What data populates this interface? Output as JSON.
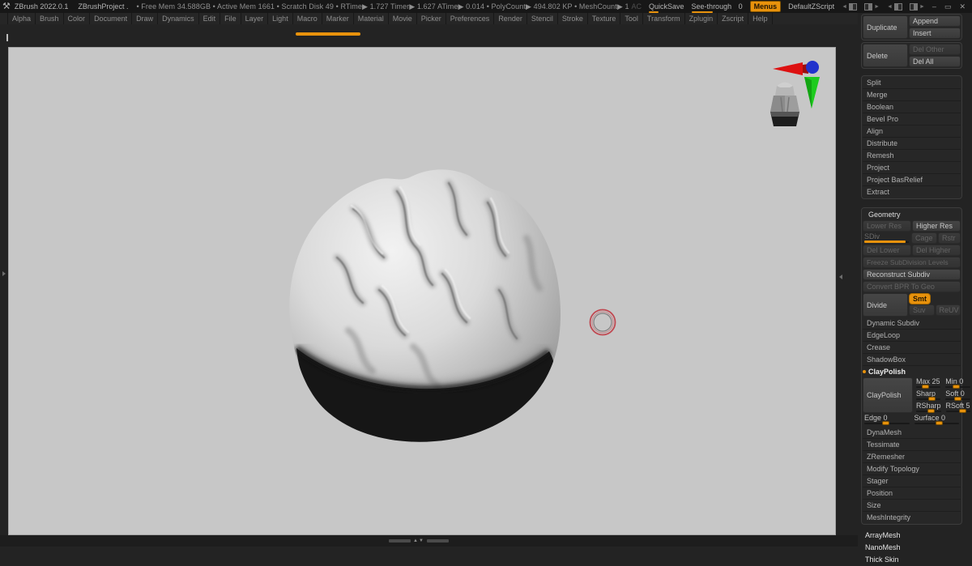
{
  "colors": {
    "accent_orange": "#e8920c",
    "canvas_grey": "#c7c7c7",
    "cursor_red": "#c04851",
    "gizmo_red": "#dd1111",
    "gizmo_green": "#1ecb1e",
    "gizmo_blue": "#2233cc"
  },
  "titlebar": {
    "app_title": "ZBrush 2022.0.1",
    "project_name": "ZBrushProject .",
    "stats": "• Free Mem 34.588GB • Active Mem 1661 • Scratch Disk 49 • RTime▶ 1.727 Timer▶ 1.627 ATime▶ 0.014 • PolyCount▶ 494.802 KP • MeshCount▶ 1",
    "ac_label": "AC",
    "quicksave_label": "QuickSave",
    "see_through_label": "See-through",
    "see_through_value": "0",
    "menus_button": "Menus",
    "default_zscript": "DefaultZScript",
    "minimize_glyph": "–",
    "restore_glyph": "▭",
    "close_glyph": "✕"
  },
  "menubar": {
    "items": [
      "Alpha",
      "Brush",
      "Color",
      "Document",
      "Draw",
      "Dynamics",
      "Edit",
      "File",
      "Layer",
      "Light",
      "Macro",
      "Marker",
      "Material",
      "Movie",
      "Picker",
      "Preferences",
      "Render",
      "Stencil",
      "Stroke",
      "Texture",
      "Tool",
      "Transform",
      "Zplugin",
      "Zscript",
      "Help"
    ]
  },
  "bottombar": {
    "divider_arrows": "▲▼"
  },
  "tool_panel": {
    "duplicate": "Duplicate",
    "append": "Append",
    "insert": "Insert",
    "delete": "Delete",
    "del_other": "Del Other",
    "del_all": "Del All",
    "subpalettes": [
      "Split",
      "Merge",
      "Boolean",
      "Bevel Pro",
      "Align",
      "Distribute",
      "Remesh",
      "Project",
      "Project BasRelief",
      "Extract"
    ],
    "geometry": {
      "header": "Geometry",
      "lower_res": "Lower Res",
      "higher_res": "Higher Res",
      "sdiv": "SDiv",
      "cage": "Cage",
      "rstr": "Rstr",
      "del_lower": "Del Lower",
      "del_higher": "Del Higher",
      "freeze_subdivision": "Freeze SubDivision Levels",
      "reconstruct_subdiv": "Reconstruct Subdiv",
      "convert_bpr": "Convert BPR To Geo",
      "divide": "Divide",
      "smt": "Smt",
      "suv": "Suv",
      "reuv": "ReUV",
      "dynamic_subdiv": "Dynamic Subdiv",
      "edgeloop": "EdgeLoop",
      "crease": "Crease",
      "shadowbox": "ShadowBox",
      "claypolish_header": "ClayPolish",
      "claypolish_button": "ClayPolish",
      "slider_max": "Max 25",
      "slider_min": "Min 0",
      "slider_sharp": "Sharp",
      "slider_soft": "Soft 0",
      "slider_rsharp": "RSharp",
      "slider_rsoft": "RSoft 5",
      "slider_edge": "Edge 0",
      "slider_surface": "Surface 0",
      "dynamesh": "DynaMesh",
      "tessimate": "Tessimate",
      "zremesher": "ZRemesher",
      "modify_topology": "Modify Topology",
      "stager": "Stager",
      "position": "Position",
      "size": "Size",
      "meshintegrity": "MeshIntegrity"
    },
    "bottom_items": [
      "ArrayMesh",
      "NanoMesh",
      "Thick Skin"
    ]
  }
}
